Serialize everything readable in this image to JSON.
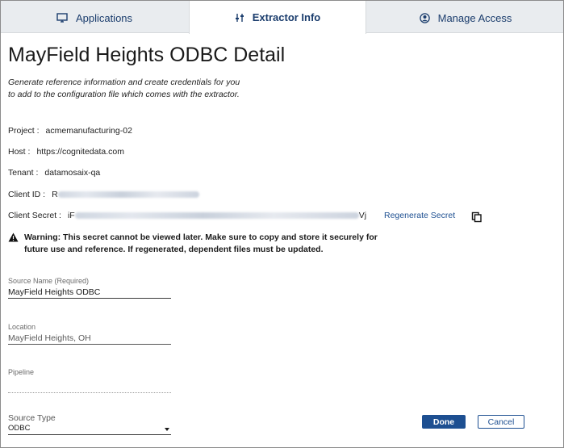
{
  "tabs": [
    {
      "label": "Applications",
      "icon": "monitor-icon"
    },
    {
      "label": "Extractor Info",
      "icon": "sliders-icon"
    },
    {
      "label": "Manage Access",
      "icon": "user-circle-icon"
    }
  ],
  "page": {
    "title": "MayField Heights ODBC Detail",
    "description": "Generate reference information and create credentials for you to add to the configuration file which comes with the extractor."
  },
  "details": {
    "project_label": "Project :",
    "project_value": "acmemanufacturing-02",
    "host_label": "Host :",
    "host_value": "https://cognitedata.com",
    "tenant_label": "Tenant :",
    "tenant_value": "datamosaix-qa",
    "client_id_label": "Client ID :",
    "client_id_prefix": "R",
    "client_secret_label": "Client Secret :",
    "client_secret_prefix": "iF",
    "client_secret_suffix": "Vj"
  },
  "actions": {
    "regenerate_label": "Regenerate Secret",
    "copy_icon": "copy-icon"
  },
  "warning": {
    "text": "Warning: This secret cannot be viewed later. Make sure to copy and store it securely for future use and reference. If regenerated, dependent files must be updated."
  },
  "form": {
    "source_name_label": "Source Name (Required)",
    "source_name_value": "MayField Heights ODBC",
    "location_label": "Location",
    "location_value": "MayField Heights, OH",
    "pipeline_label": "Pipeline",
    "pipeline_value": "",
    "source_type_label": "Source Type",
    "source_type_value": "ODBC"
  },
  "buttons": {
    "done": "Done",
    "cancel": "Cancel"
  },
  "colors": {
    "accent": "#1d4f91",
    "tab_bar": "#e9ecef"
  }
}
